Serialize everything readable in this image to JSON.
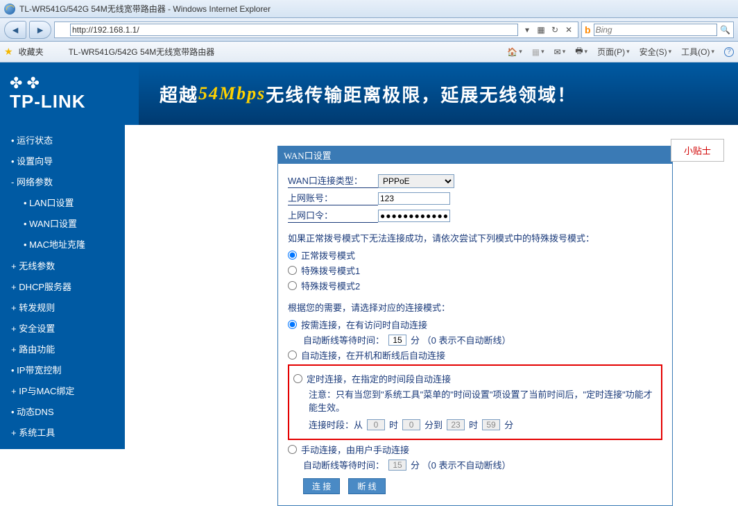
{
  "window": {
    "title": "TL-WR541G/542G 54M无线宽带路由器 - Windows Internet Explorer"
  },
  "address": {
    "url": "http://192.168.1.1/"
  },
  "search": {
    "placeholder": "Bing"
  },
  "favorites": {
    "label": "收藏夹",
    "tab_title": "TL-WR541G/542G 54M无线宽带路由器"
  },
  "toolbar_menus": {
    "page": "页面(P)",
    "safety": "安全(S)",
    "tools": "工具(O)"
  },
  "banner": {
    "logo": "TP-LINK",
    "slogan_pre": "超越 ",
    "slogan_speed": "54Mbps",
    "slogan_post": " 无线传输距离极限，延展无线领域！"
  },
  "sidebar": {
    "items": [
      "• 运行状态",
      "• 设置向导",
      "- 网络参数",
      "• LAN口设置",
      "• WAN口设置",
      "• MAC地址克隆",
      "+ 无线参数",
      "+ DHCP服务器",
      "+ 转发规则",
      "+ 安全设置",
      "+ 路由功能",
      "• IP带宽控制",
      "+ IP与MAC绑定",
      "• 动态DNS",
      "+ 系统工具"
    ]
  },
  "panel": {
    "header": "WAN口设置",
    "conn_type_label": "WAN口连接类型：",
    "conn_type_value": "PPPoE",
    "account_label": "上网账号：",
    "account_value": "123",
    "password_label": "上网口令：",
    "password_value": "●●●●●●●●●●●●●",
    "dial_note": "如果正常拨号模式下无法连接成功，请依次尝试下列模式中的特殊拨号模式：",
    "dial_modes": [
      "正常拨号模式",
      "特殊拨号模式1",
      "特殊拨号模式2"
    ],
    "need_note": "根据您的需要，请选择对应的连接模式：",
    "mode_on_demand": "按需连接，在有访问时自动连接",
    "auto_disc_label": "自动断线等待时间：",
    "auto_disc_value": "15",
    "auto_disc_unit": "分  （0 表示不自动断线）",
    "mode_auto": "自动连接，在开机和断线后自动连接",
    "mode_timed": "定时连接，在指定的时间段自动连接",
    "timed_note": "注意：只有当您到\"系统工具\"菜单的\"时间设置\"项设置了当前时间后，\"定时连接\"功能才能生效。",
    "time_range_label": "连接时段：从",
    "time_h1": "0",
    "time_m1": "0",
    "time_h2": "23",
    "time_m2": "59",
    "time_h_unit": "时",
    "time_m_unit": "分到",
    "time_m_unit2": "分",
    "mode_manual": "手动连接，由用户手动连接",
    "manual_disc_value": "15",
    "btn_connect": "连 接",
    "btn_disconnect": "断 线"
  },
  "tips": {
    "label": "小贴士"
  }
}
